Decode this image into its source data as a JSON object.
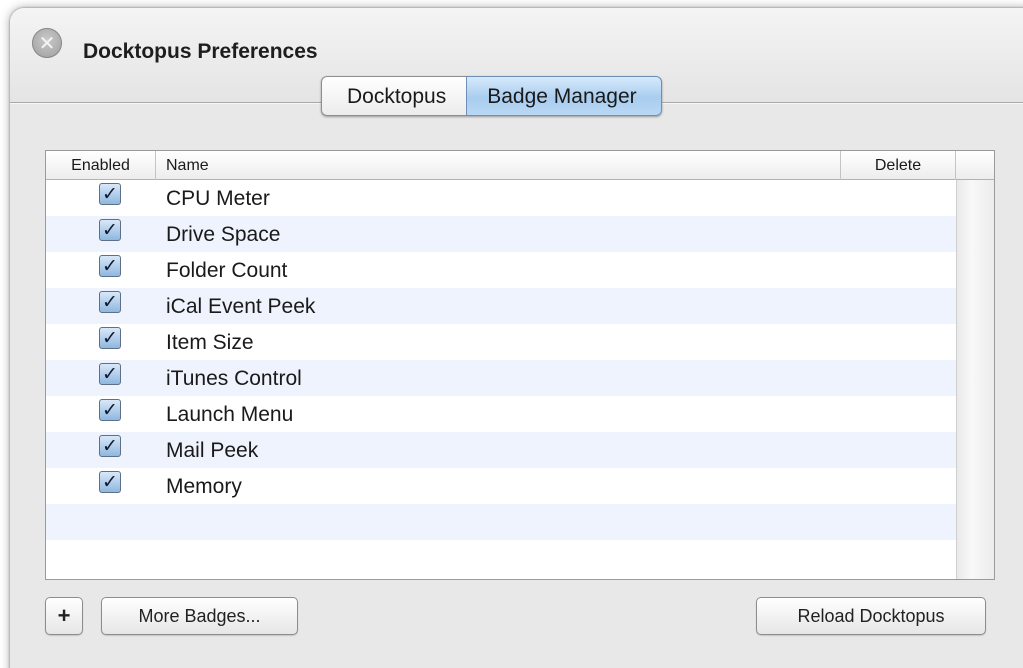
{
  "window": {
    "title": "Docktopus Preferences",
    "close_glyph": "✕"
  },
  "tabs": [
    {
      "label": "Docktopus",
      "selected": false
    },
    {
      "label": "Badge Manager",
      "selected": true
    }
  ],
  "table": {
    "columns": {
      "enabled": "Enabled",
      "name": "Name",
      "delete": "Delete"
    },
    "check_glyph": "✓",
    "rows": [
      {
        "enabled": true,
        "name": "CPU Meter"
      },
      {
        "enabled": true,
        "name": "Drive Space"
      },
      {
        "enabled": true,
        "name": "Folder Count"
      },
      {
        "enabled": true,
        "name": "iCal Event Peek"
      },
      {
        "enabled": true,
        "name": "Item Size"
      },
      {
        "enabled": true,
        "name": "iTunes Control"
      },
      {
        "enabled": true,
        "name": "Launch Menu"
      },
      {
        "enabled": true,
        "name": "Mail Peek"
      },
      {
        "enabled": true,
        "name": "Memory"
      }
    ]
  },
  "buttons": {
    "add_label": "+",
    "more_label": "More Badges...",
    "reload_label": "Reload Docktopus"
  },
  "colors": {
    "selected_tab": "#a9cdef",
    "row_stripe": "#eef3fd",
    "window_bg": "#e8e8e8"
  }
}
